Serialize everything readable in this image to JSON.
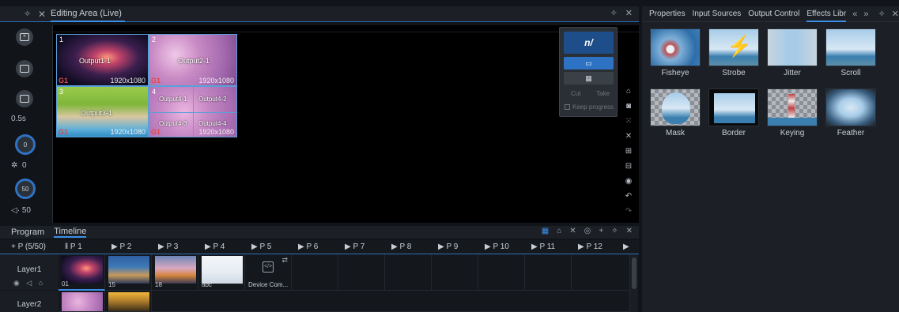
{
  "editing_area": {
    "title": "Editing Area (Live)",
    "outputs": [
      {
        "num": "1",
        "name": "Output1-1",
        "res": "1920x1080",
        "group": "G1"
      },
      {
        "num": "2",
        "name": "Output2-1",
        "res": "1920x1080",
        "group": "G1"
      },
      {
        "num": "3",
        "name": "Output3-1",
        "res": "1920x1080",
        "group": "G1"
      },
      {
        "num": "4",
        "name": "Output4-1",
        "name2": "Output4-2",
        "name3": "Output4-3",
        "name4": "Output4-4",
        "res": "1920x1080",
        "group": "G1"
      }
    ],
    "left_tools": {
      "time": "0.5s",
      "brightness_value": "0",
      "brightness_knob": "0",
      "volume_value": "50",
      "volume_knob": "50"
    },
    "float_panel": {
      "cut": "Cut",
      "take": "Take",
      "keep_progress": "Keep progress"
    }
  },
  "program": {
    "tabs": [
      "Program",
      "Timeline"
    ],
    "add_page": "+ P (5/50)",
    "pages": [
      "P 1",
      "P 2",
      "P 3",
      "P 4",
      "P 5",
      "P 6",
      "P 7",
      "P 8",
      "P 9",
      "P 10",
      "P 11",
      "P 12"
    ],
    "layers": [
      {
        "name": "Layer1",
        "cells": [
          "01",
          "15",
          "18",
          "abc",
          "Device Com..."
        ]
      },
      {
        "name": "Layer2",
        "cells": [
          "",
          ""
        ]
      }
    ]
  },
  "right_panel": {
    "tabs": [
      "Properties",
      "Input Sources",
      "Output Control",
      "Effects Libr"
    ],
    "active_tab": "Effects Libr",
    "effects": [
      "Fisheye",
      "Strobe",
      "Jitter",
      "Scroll",
      "Mask",
      "Border",
      "Keying",
      "Feather"
    ]
  },
  "colors": {
    "accent": "#3b8ee6",
    "background": "#111418",
    "panel": "#1c2026",
    "group_red": "#e04848"
  }
}
